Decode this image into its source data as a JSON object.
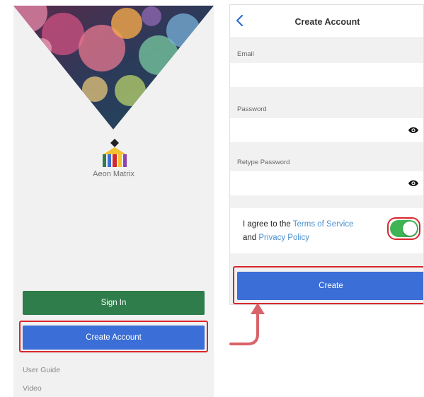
{
  "left_screen": {
    "brand": "Aeon Matrix",
    "sign_in_label": "Sign In",
    "create_account_label": "Create Account",
    "links": [
      "User Guide",
      "Video"
    ]
  },
  "right_screen": {
    "title": "Create Account",
    "fields": [
      {
        "label": "Email",
        "value": "",
        "icon": null
      },
      {
        "label": "Password",
        "value": "",
        "icon": "eye-icon"
      },
      {
        "label": "Retype Password",
        "value": "",
        "icon": "eye-icon"
      }
    ],
    "agreement": {
      "prefix": "I agree to the ",
      "terms": "Terms of Service",
      "middle": "and ",
      "privacy": "Privacy Policy",
      "toggle_on": true
    },
    "create_label": "Create"
  },
  "colors": {
    "sign_in": "#2e7d4a",
    "primary_blue": "#3b6ed6",
    "toggle_on": "#3fb455",
    "highlight": "#d9262c",
    "arrow": "#d9636a",
    "link": "#4a8fd0"
  },
  "icons": [
    "back-chevron-icon",
    "eye-icon",
    "aeon-matrix-logo",
    "curved-arrow-icon"
  ]
}
